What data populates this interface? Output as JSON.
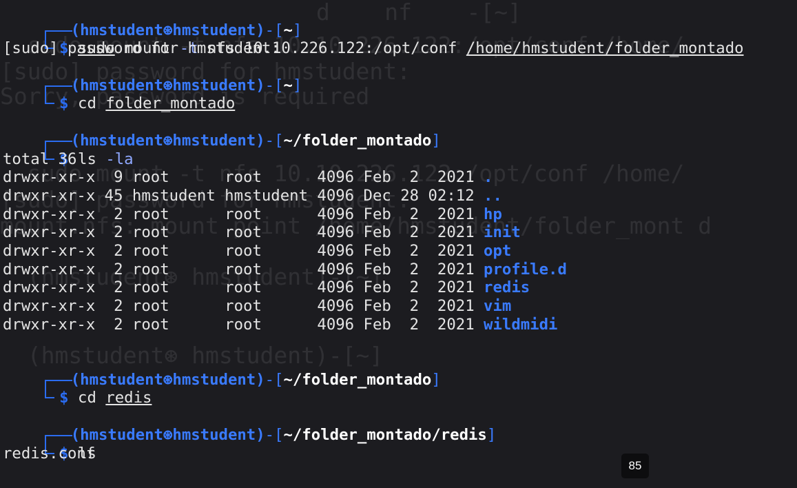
{
  "prompt": {
    "user": "hmstudent",
    "host": "hmstudent",
    "at_icon": "⊛",
    "symbol": "$"
  },
  "blocks": [
    {
      "cwd": "~",
      "cmd": "sudo",
      "args": " mount ",
      "flag": "-t",
      "rest": " nfs 10.10.226.122:/opt/conf ",
      "target": "/home/hmstudent/folder_montado"
    },
    {
      "cwd": "~",
      "cmd": "cd",
      "target": "folder_montado"
    },
    {
      "cwd": "~/folder_montado",
      "cmd": "ls",
      "flag": "-la"
    },
    {
      "cwd": "~/folder_montado",
      "cmd": "cd",
      "target": "redis"
    },
    {
      "cwd": "~/folder_montado/redis",
      "cmd": "ls"
    }
  ],
  "output": {
    "sudo_prompt": "[sudo] password for hmstudent:",
    "total": "total 36",
    "listing": [
      {
        "meta": "drwxr-xr-x  9 root      root      4096 Feb  2  2021 ",
        "name": "."
      },
      {
        "meta": "drwxr-xr-x 45 hmstudent hmstudent 4096 Dec 28 02:12 ",
        "name": ".."
      },
      {
        "meta": "drwxr-xr-x  2 root      root      4096 Feb  2  2021 ",
        "name": "hp"
      },
      {
        "meta": "drwxr-xr-x  2 root      root      4096 Feb  2  2021 ",
        "name": "init"
      },
      {
        "meta": "drwxr-xr-x  2 root      root      4096 Feb  2  2021 ",
        "name": "opt"
      },
      {
        "meta": "drwxr-xr-x  2 root      root      4096 Feb  2  2021 ",
        "name": "profile.d"
      },
      {
        "meta": "drwxr-xr-x  2 root      root      4096 Feb  2  2021 ",
        "name": "redis"
      },
      {
        "meta": "drwxr-xr-x  2 root      root      4096 Feb  2  2021 ",
        "name": "vim"
      },
      {
        "meta": "drwxr-xr-x  2 root      root      4096 Feb  2  2021 ",
        "name": "wildmidi"
      }
    ],
    "redis_ls": "redis.conf"
  },
  "ghost": {
    "l1": "        d    nf    -[~]",
    "l2": "  sudo mount -t nfs 10.10.226.122:/opt/conf /home/",
    "l3": "[sudo] password for hmstudent:",
    "l4": "Sorry, password is required",
    "l5": "  sudo mount -t nfs 10.10.226.122:/opt/conf /home/",
    "l6": "[sudo] password for hmstudent:",
    "l7": "mount.nfs: mount point /home/hmstudent/folder_mont d",
    "l8": "  (hmstudent⊛ hmstudent)-[~]",
    "l9": "  (hmstudent⊛ hmstudent)-[~]"
  },
  "badge": "85"
}
